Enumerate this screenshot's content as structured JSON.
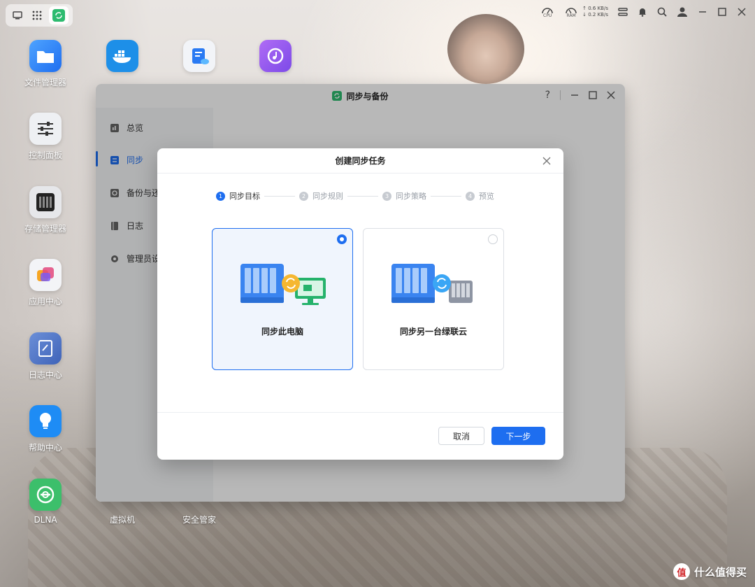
{
  "desktop_icons": [
    {
      "label": "文件管理器",
      "icon": "folder-icon"
    },
    {
      "label": "",
      "icon": "docker-icon"
    },
    {
      "label": "",
      "icon": "notes-icon"
    },
    {
      "label": "",
      "icon": "music-icon"
    },
    {
      "label": "控制面板",
      "icon": "sliders-icon"
    },
    {
      "label": "存储管理器",
      "icon": "storage-icon"
    },
    {
      "label": "应用中心",
      "icon": "apps-icon"
    },
    {
      "label": "日志中心",
      "icon": "log-icon"
    },
    {
      "label": "帮助中心",
      "icon": "bulb-icon"
    },
    {
      "label": "DLNA",
      "icon": "dlna-icon"
    },
    {
      "label": "虚拟机",
      "icon": "vm-icon"
    },
    {
      "label": "安全管家",
      "icon": "shield-icon"
    }
  ],
  "topbar": {
    "cpu_label": "CPU",
    "ram_label": "RAM",
    "upload": "↑ 0.6 KB/s",
    "download": "↓ 0.2 KB/s"
  },
  "window": {
    "title": "同步与备份",
    "help": "?",
    "sidebar": [
      {
        "label": "总览",
        "icon": "overview-icon",
        "active": false
      },
      {
        "label": "同步",
        "icon": "sync-icon",
        "active": true
      },
      {
        "label": "备份与还",
        "icon": "backup-icon",
        "active": false
      },
      {
        "label": "日志",
        "icon": "log-icon",
        "active": false
      },
      {
        "label": "管理员设",
        "icon": "gear-icon",
        "active": false
      }
    ]
  },
  "modal": {
    "title": "创建同步任务",
    "steps": [
      {
        "num": "1",
        "label": "同步目标"
      },
      {
        "num": "2",
        "label": "同步规则"
      },
      {
        "num": "3",
        "label": "同步策略"
      },
      {
        "num": "4",
        "label": "预览"
      }
    ],
    "current_step": 1,
    "options": [
      {
        "label": "同步此电脑",
        "selected": true
      },
      {
        "label": "同步另一台绿联云",
        "selected": false
      }
    ],
    "cancel_label": "取消",
    "next_label": "下一步"
  },
  "watermark": {
    "logo": "值",
    "text": "什么值得买"
  },
  "colors": {
    "accent": "#1e6ef0",
    "brand_green": "#2dbb6f"
  }
}
